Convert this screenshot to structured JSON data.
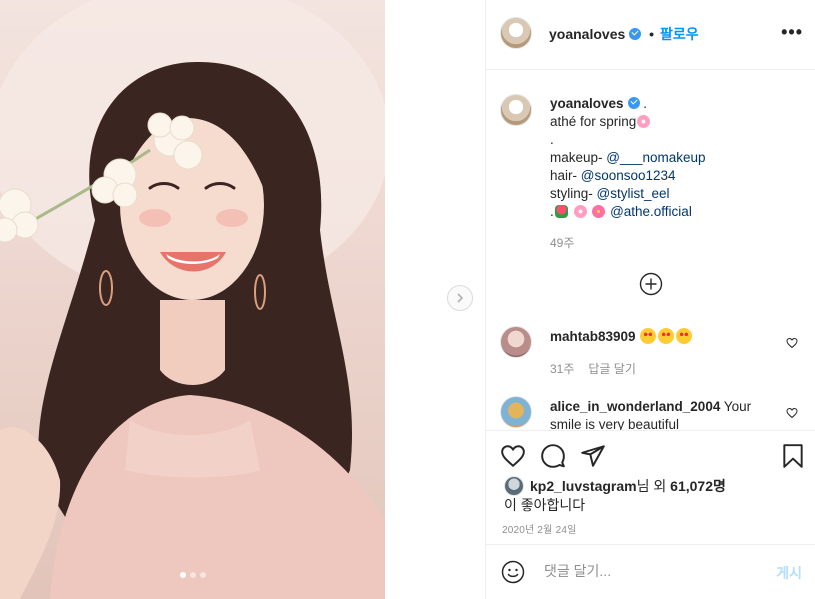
{
  "post": {
    "username": "yoanaloves",
    "separator": "•",
    "follow_label": "팔로우",
    "more_label": "•••"
  },
  "caption": {
    "username": "yoanaloves",
    "after_name": " .",
    "line1": "athé for spring",
    "line2": ".",
    "makeup_label": "makeup- ",
    "makeup_mention": "@___nomakeup",
    "hair_label": "hair- ",
    "hair_mention": "@soonsoo1234",
    "styling_label": "styling- ",
    "styling_mention": "@stylist_eel",
    "brand_prefix": ".",
    "brand_mention": "@athe.official",
    "time": "49주"
  },
  "comments": [
    {
      "username": "mahtab83909",
      "text": "",
      "time": "31주",
      "reply_label": "답글 달기"
    },
    {
      "username": "alice_in_wonderland_2004",
      "text": " Your smile is very beautiful"
    }
  ],
  "likes": {
    "liker": "kp2_luvstagram",
    "text_mid": "님 외 ",
    "count": "61,072명",
    "text_end": "이 좋아합니다"
  },
  "date": "2020년 2월 24일",
  "composer": {
    "placeholder": "댓글 달기...",
    "post_label": "게시"
  },
  "carousel": {
    "slides": 3,
    "active": 1
  },
  "colors": {
    "accent": "#0095f6",
    "verified": "#3897f0",
    "muted": "#8e8e8e"
  }
}
